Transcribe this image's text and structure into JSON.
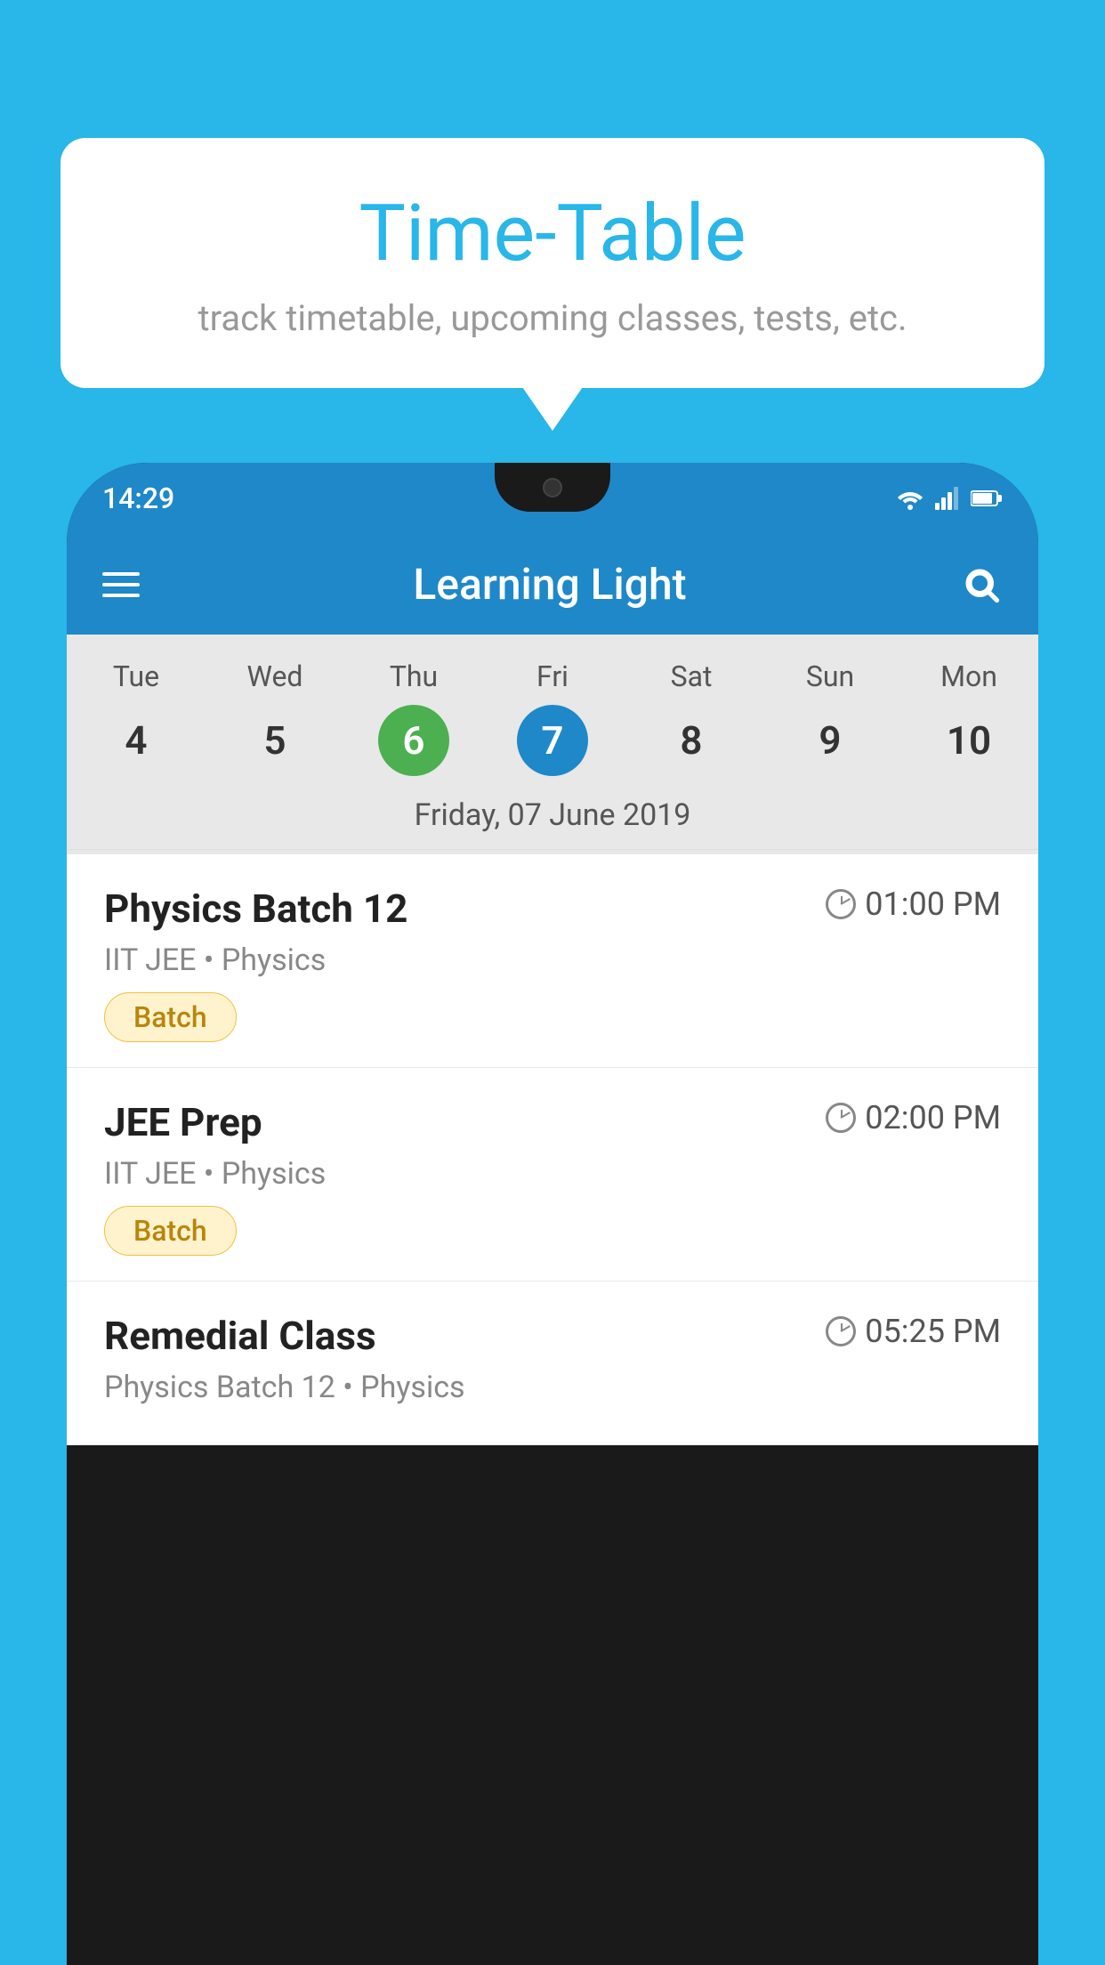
{
  "background_color": "#29b6e8",
  "tooltip": {
    "title": "Time-Table",
    "subtitle": "track timetable, upcoming classes, tests, etc."
  },
  "phone": {
    "status_bar": {
      "time": "14:29",
      "icons": [
        "wifi",
        "signal",
        "battery"
      ]
    },
    "app_header": {
      "title": "Learning Light",
      "menu_icon": "hamburger-icon",
      "search_icon": "search-icon"
    },
    "calendar": {
      "days": [
        "Tue",
        "Wed",
        "Thu",
        "Fri",
        "Sat",
        "Sun",
        "Mon"
      ],
      "dates": [
        "4",
        "5",
        "6",
        "7",
        "8",
        "9",
        "10"
      ],
      "today_index": 2,
      "selected_index": 3,
      "selected_label": "Friday, 07 June 2019"
    },
    "classes": [
      {
        "name": "Physics Batch 12",
        "time": "01:00 PM",
        "details": "IIT JEE • Physics",
        "badge": "Batch"
      },
      {
        "name": "JEE Prep",
        "time": "02:00 PM",
        "details": "IIT JEE • Physics",
        "badge": "Batch"
      },
      {
        "name": "Remedial Class",
        "time": "05:25 PM",
        "details": "Physics Batch 12 • Physics",
        "badge": ""
      }
    ]
  }
}
